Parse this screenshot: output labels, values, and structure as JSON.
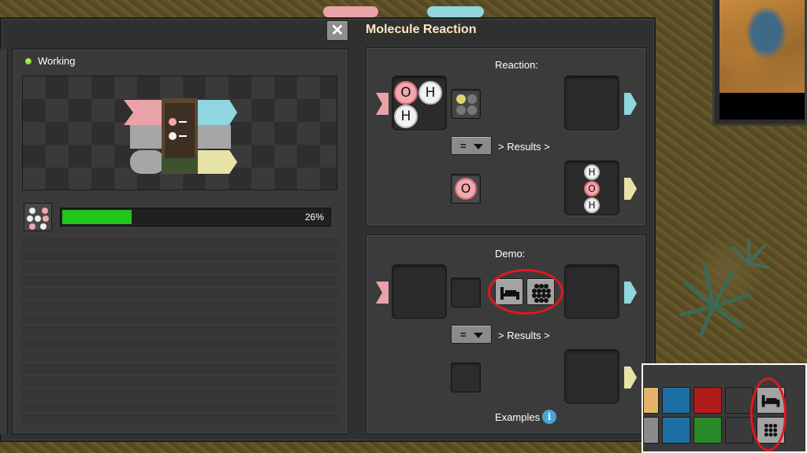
{
  "window": {
    "title": "Molecule Reaction",
    "close_label": "✕"
  },
  "machine": {
    "status": "Working",
    "status_color": "#7ad932",
    "progress_fraction": 0.26,
    "progress_text": "26%"
  },
  "reaction_panel": {
    "heading": "Reaction:",
    "operator": "=",
    "results_label": "> Results >",
    "input_molecule": {
      "atoms": [
        "O",
        "H",
        "H"
      ]
    },
    "selector_atom": "O",
    "output_molecule": {
      "atoms": [
        "H",
        "O",
        "H"
      ]
    }
  },
  "demo_panel": {
    "heading": "Demo:",
    "operator": "=",
    "results_label": "> Results >",
    "examples_label": "Examples",
    "info_icon": "i"
  },
  "colors": {
    "input_arrow": "#e9a3a8",
    "output_arrow_top": "#8fd6df",
    "output_arrow_bottom": "#e7e3a6",
    "progress": "#21c51d",
    "highlight_ring": "#e01820",
    "oxygen": "#f1a8ad",
    "hydrogen": "#f2f2f2"
  },
  "icons": {
    "close": "close-icon",
    "info": "info-icon",
    "demo_tool_1": "bed-icon",
    "demo_tool_2": "dot-grid-icon"
  }
}
